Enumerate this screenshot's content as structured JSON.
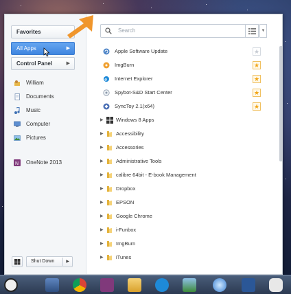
{
  "left_panel": {
    "favorites_label": "Favorites",
    "all_apps_label": "All Apps",
    "control_panel_label": "Control Panel",
    "places": [
      {
        "label": "William",
        "icon": "user-folder-icon"
      },
      {
        "label": "Documents",
        "icon": "documents-icon"
      },
      {
        "label": "Music",
        "icon": "music-icon"
      },
      {
        "label": "Computer",
        "icon": "computer-icon"
      },
      {
        "label": "Pictures",
        "icon": "pictures-icon"
      },
      {
        "label": "OneNote 2013",
        "icon": "onenote-icon"
      }
    ],
    "shutdown_label": "Shut Down"
  },
  "search": {
    "placeholder": "Search"
  },
  "apps": [
    {
      "label": "Apple Software Update",
      "pinned": false,
      "icon": "apple-update-icon"
    },
    {
      "label": "ImgBurn",
      "pinned": true,
      "icon": "imgburn-icon"
    },
    {
      "label": "Internet Explorer",
      "pinned": true,
      "icon": "ie-icon"
    },
    {
      "label": "Spybot-S&D Start Center",
      "pinned": true,
      "icon": "spybot-icon"
    },
    {
      "label": "SyncToy 2.1(x64)",
      "pinned": true,
      "icon": "synctoy-icon"
    }
  ],
  "folders": [
    {
      "label": "Windows 8 Apps",
      "icon": "windows-icon"
    },
    {
      "label": "Accessibility",
      "icon": "folder-icon"
    },
    {
      "label": "Accessories",
      "icon": "folder-icon"
    },
    {
      "label": "Administrative Tools",
      "icon": "folder-icon"
    },
    {
      "label": "calibre 64bit - E-book Management",
      "icon": "folder-icon"
    },
    {
      "label": "Dropbox",
      "icon": "folder-icon"
    },
    {
      "label": "EPSON",
      "icon": "folder-icon"
    },
    {
      "label": "Google Chrome",
      "icon": "folder-icon"
    },
    {
      "label": "i-Funbox",
      "icon": "folder-icon"
    },
    {
      "label": "ImgBurn",
      "icon": "folder-icon"
    },
    {
      "label": "iTunes",
      "icon": "folder-icon"
    }
  ],
  "taskbar": {
    "items": [
      "start-button",
      "explorer-icon",
      "chrome-icon",
      "onenote-icon",
      "file-explorer-icon",
      "ie-icon",
      "photo-viewer-icon",
      "itunes-icon",
      "word-icon",
      "som-app-icon"
    ]
  },
  "colors": {
    "accent": "#4a8fe6",
    "star": "#f2a516",
    "annotation_arrow": "#f0962c"
  }
}
